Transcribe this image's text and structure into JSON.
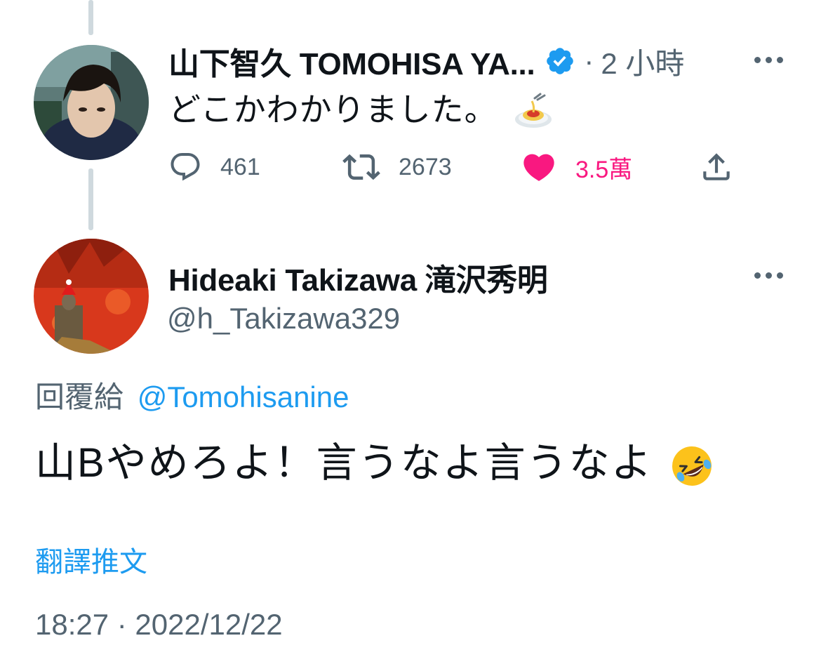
{
  "tweet1": {
    "display_name": "山下智久 TOMOHISA YA...",
    "separator": "·",
    "time_ago": "2 小時",
    "text": "どこかわかりました。",
    "emoji": "spaghetti",
    "stats": {
      "replies": "461",
      "retweets": "2673",
      "likes": "3.5萬"
    }
  },
  "tweet2": {
    "display_name": "Hideaki Takizawa 滝沢秀明",
    "handle": "@h_Takizawa329",
    "reply_prefix": "回覆給",
    "reply_mention": "@Tomohisanine",
    "text": "山Bやめろよ！言うなよ言うなよ",
    "emoji": "rolling-on-floor-laughing",
    "translate_label": "翻譯推文",
    "timestamp": "18:27 · 2022/12/22"
  },
  "colors": {
    "text": "#0f1419",
    "secondary": "#536471",
    "link": "#1d9bf0",
    "like": "#f91880",
    "thread": "#cfd9de"
  }
}
